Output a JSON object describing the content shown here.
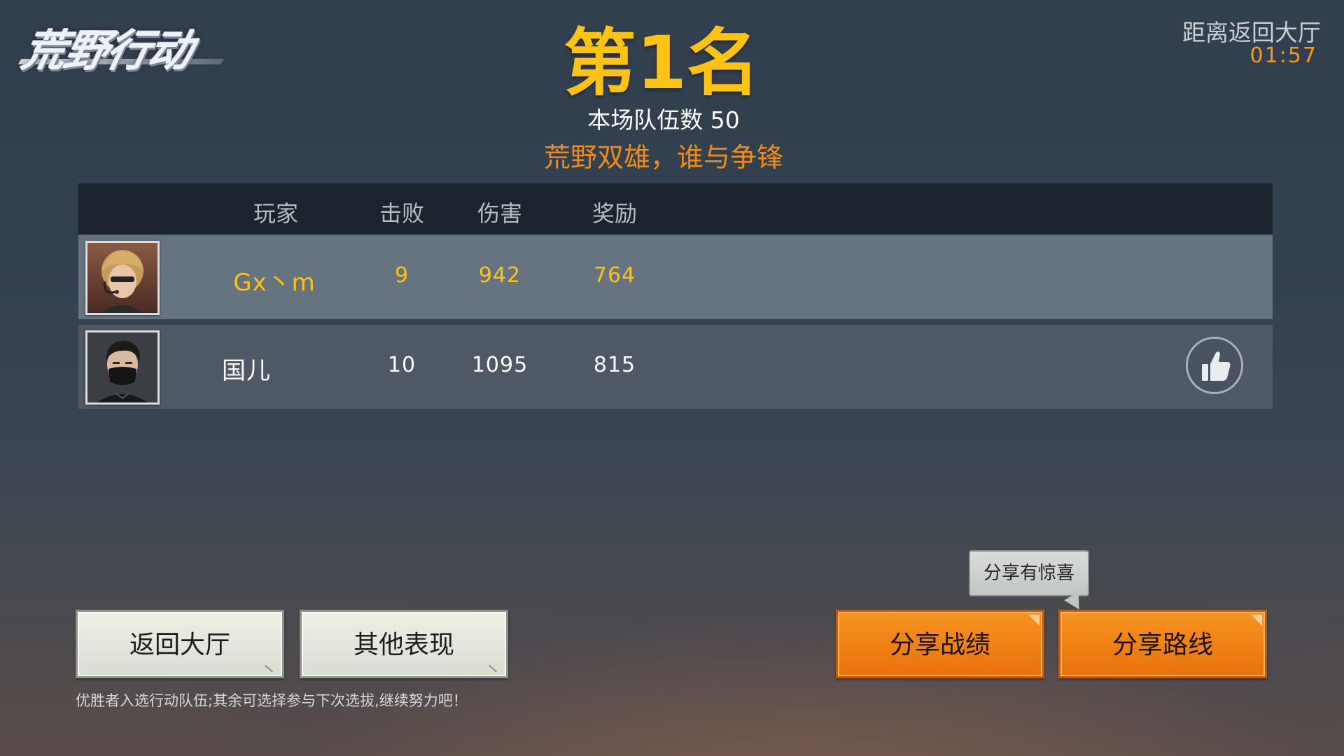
{
  "game": {
    "logo_text": "荒野行动"
  },
  "countdown": {
    "label": "距离返回大厅",
    "time": "01:57"
  },
  "result": {
    "rank_title": "第1名",
    "team_count": "本场队伍数 50",
    "slogan": "荒野双雄，谁与争锋"
  },
  "table": {
    "headers": {
      "player": "玩家",
      "kills": "击败",
      "damage": "伤害",
      "reward": "奖励"
    },
    "rows": [
      {
        "name": "Gx丶m",
        "kills": "9",
        "damage": "942",
        "reward": "764",
        "avatar": "avatar-blonde-headset"
      },
      {
        "name": "国儿",
        "kills": "10",
        "damage": "1095",
        "reward": "815",
        "avatar": "avatar-masked-dark-hair"
      }
    ]
  },
  "icons": {
    "like": "thumbs-up-icon"
  },
  "buttons": {
    "return_lobby": "返回大厅",
    "other_performance": "其他表现",
    "share_stats": "分享战绩",
    "share_route": "分享路线"
  },
  "tooltip": {
    "text": "分享有惊喜"
  },
  "hint": {
    "text": "优胜者入选行动队伍;其余可选择参与下次选拔,继续努力吧！"
  },
  "colors": {
    "rank_gold": "#ffc316",
    "accent_orange": "#f08c16",
    "button_orange": "#f7931f",
    "highlight_row": "#667380"
  }
}
